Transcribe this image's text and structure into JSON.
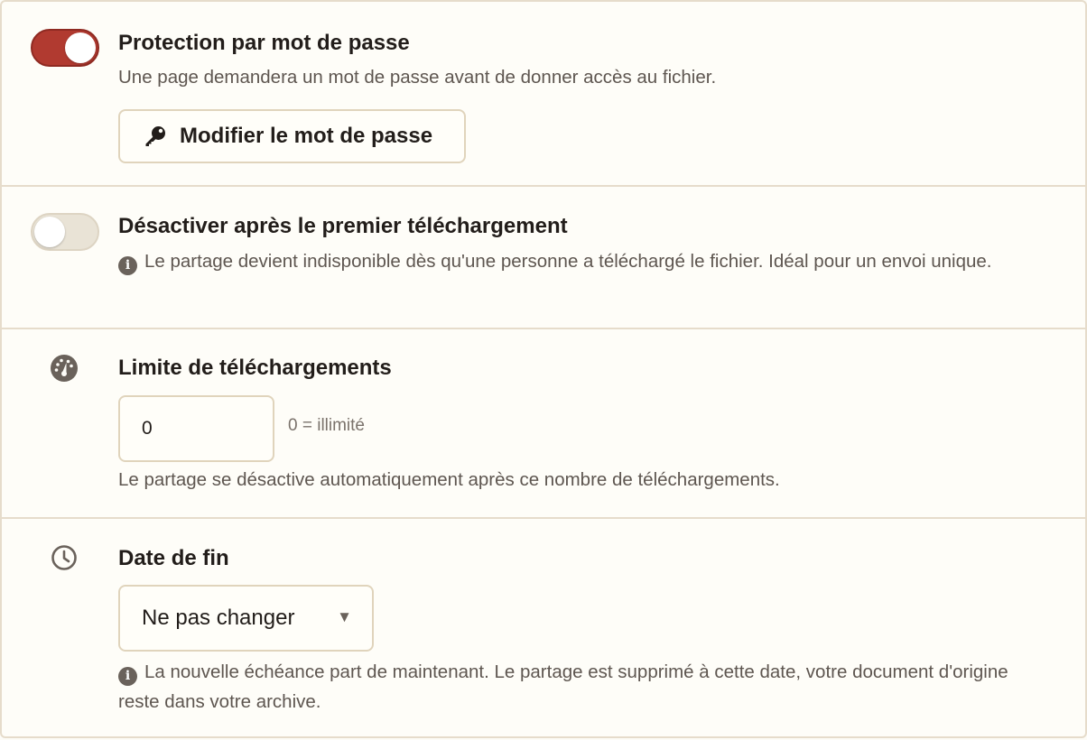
{
  "password": {
    "enabled": true,
    "title": "Protection par mot de passe",
    "description": "Une page demandera un mot de passe avant de donner accès au fichier.",
    "button_label": "Modifier le mot de passe",
    "button_icon": "key-icon"
  },
  "one_time": {
    "enabled": false,
    "title": "Désactiver après le premier téléchargement",
    "description": "Le partage devient indisponible dès qu'une personne a téléchargé le fichier. Idéal pour un envoi unique."
  },
  "download_limit": {
    "icon": "gauge-icon",
    "title": "Limite de téléchargements",
    "value": "0",
    "hint": "0 = illimité",
    "description": "Le partage se désactive automatiquement après ce nombre de téléchargements."
  },
  "end_date": {
    "icon": "clock-icon",
    "title": "Date de fin",
    "selected": "Ne pas changer",
    "description": "La nouvelle échéance part de maintenant. Le partage est supprimé à cette date, votre document d'origine reste dans votre archive."
  },
  "colors": {
    "toggle_on": "#b13a30",
    "toggle_off": "#e9e3d6",
    "border": "#e6dccb",
    "background": "#fefdf8"
  }
}
